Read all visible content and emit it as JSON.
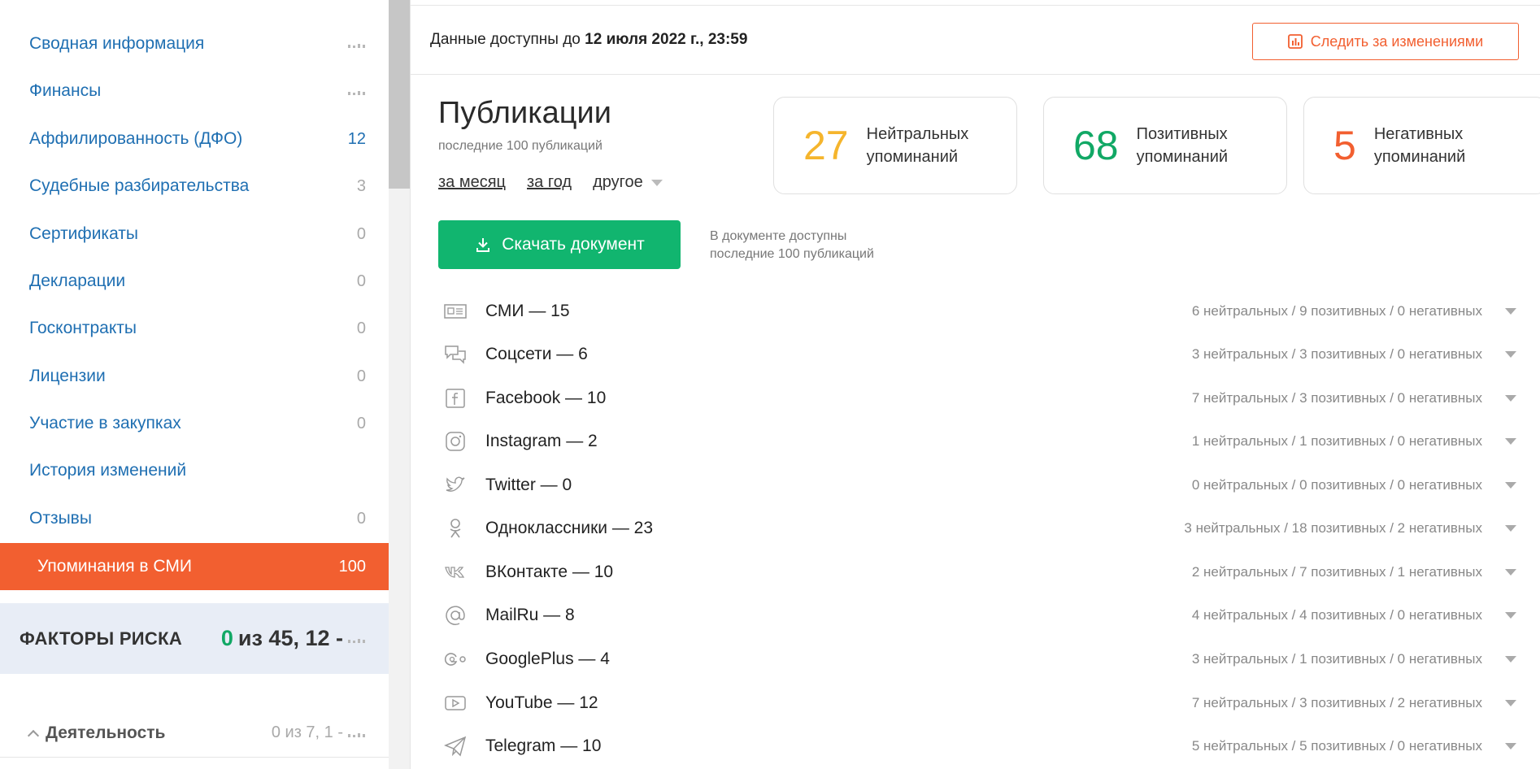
{
  "sidebar": {
    "items": [
      {
        "label": "Сводная информация",
        "count": "",
        "mini": true
      },
      {
        "label": "Финансы",
        "count": "",
        "mini": true
      },
      {
        "label": "Аффилированность (ДФО)",
        "count": "12",
        "mini": false
      },
      {
        "label": "Судебные разбирательства",
        "count": "3",
        "mini": false
      },
      {
        "label": "Сертификаты",
        "count": "0",
        "mini": false
      },
      {
        "label": "Декларации",
        "count": "0",
        "mini": false
      },
      {
        "label": "Госконтракты",
        "count": "0",
        "mini": false
      },
      {
        "label": "Лицензии",
        "count": "0",
        "mini": false
      },
      {
        "label": "Участие в закупках",
        "count": "0",
        "mini": false
      },
      {
        "label": "История изменений",
        "count": "",
        "mini": false
      },
      {
        "label": "Отзывы",
        "count": "0",
        "mini": false
      }
    ],
    "active": {
      "label": "Упоминания в СМИ",
      "count": "100"
    },
    "risk": {
      "title": "ФАКТОРЫ РИСКА",
      "score_green": "0",
      "score_rest": "из 45, 12 -"
    },
    "activity": {
      "label": "Деятельность",
      "score": "0 из 7, 1 -"
    }
  },
  "topbar": {
    "avail_prefix": "Данные доступны до",
    "avail_date": "12 июля 2022 г., 23:59",
    "follow_label": "Следить за изменениями"
  },
  "publications": {
    "title": "Публикации",
    "subtitle": "последние 100 публикаций",
    "period": {
      "month": "за месяц",
      "year": "за год",
      "other": "другое"
    },
    "stats": [
      {
        "num": "27",
        "label1": "Нейтральных",
        "label2": "упоминаний",
        "color": "#f5b52d"
      },
      {
        "num": "68",
        "label1": "Позитивных",
        "label2": "упоминаний",
        "color": "#11a865"
      },
      {
        "num": "5",
        "label1": "Негативных",
        "label2": "упоминаний",
        "color": "#f25f30"
      }
    ],
    "download_label": "Скачать документ",
    "download_note1": "В документе доступны",
    "download_note2": "последние 100 публикаций",
    "sources": [
      {
        "name": "СМИ — 15",
        "stat": "6 нейтральных / 9 позитивных / 0 негативных",
        "icon": "newspaper-icon"
      },
      {
        "name": "Соцсети — 6",
        "stat": "3 нейтральных / 3 позитивных / 0 негативных",
        "icon": "chat-icon"
      },
      {
        "name": "Facebook — 10",
        "stat": "7 нейтральных / 3 позитивных / 0 негативных",
        "icon": "facebook-icon"
      },
      {
        "name": "Instagram — 2",
        "stat": "1 нейтральных / 1 позитивных / 0 негативных",
        "icon": "instagram-icon"
      },
      {
        "name": "Twitter — 0",
        "stat": "0 нейтральных / 0 позитивных / 0 негативных",
        "icon": "twitter-icon"
      },
      {
        "name": "Одноклассники — 23",
        "stat": "3 нейтральных / 18 позитивных / 2 негативных",
        "icon": "odnoklassniki-icon"
      },
      {
        "name": "ВКонтакте — 10",
        "stat": "2 нейтральных / 7 позитивных / 1 негативных",
        "icon": "vk-icon"
      },
      {
        "name": "MailRu — 8",
        "stat": "4 нейтральных / 4 позитивных / 0 негативных",
        "icon": "at-icon"
      },
      {
        "name": "GooglePlus — 4",
        "stat": "3 нейтральных / 1 позитивных / 0 негативных",
        "icon": "googleplus-icon"
      },
      {
        "name": "YouTube — 12",
        "stat": "7 нейтральных / 3 позитивных / 2 негативных",
        "icon": "youtube-icon"
      },
      {
        "name": "Telegram — 10",
        "stat": "5 нейтральных / 5 позитивных / 0 негативных",
        "icon": "telegram-icon"
      }
    ]
  }
}
